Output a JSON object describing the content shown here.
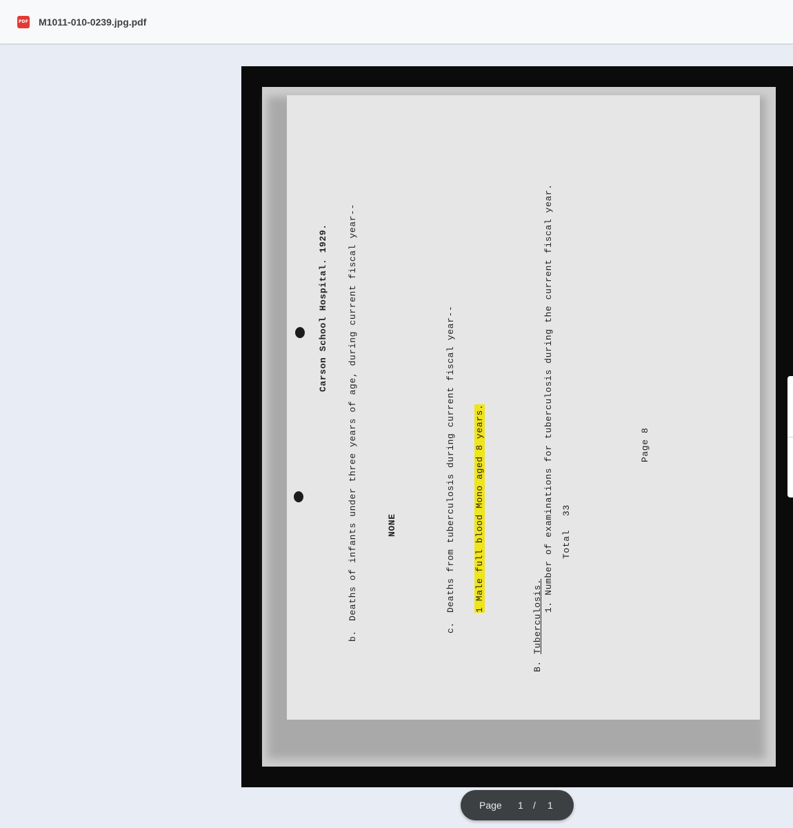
{
  "app": {
    "file_badge": "PDF",
    "file_name": "M1011-010-0239.jpg.pdf"
  },
  "document": {
    "lines": {
      "title": "Carson School Hospital. 1929.",
      "b_label": "b.",
      "b_text": "Deaths of infants under three years of age, during current fiscal year--",
      "none": "NONE",
      "c_label": "c.",
      "c_text": "Deaths from tuberculosis during current fiscal year--",
      "c_entry": "1 Male    full blood Mono  aged 8 years.",
      "B_label": "B.",
      "B_heading": "Tuberculosis.",
      "item1": "1. Number of examinations for tuberculosis during the current fiscal year.",
      "total_label": "Total",
      "total_value": "33",
      "page_label": "Page 8"
    }
  },
  "pagination": {
    "label": "Page",
    "current": "1",
    "separator": "/",
    "total": "1"
  }
}
